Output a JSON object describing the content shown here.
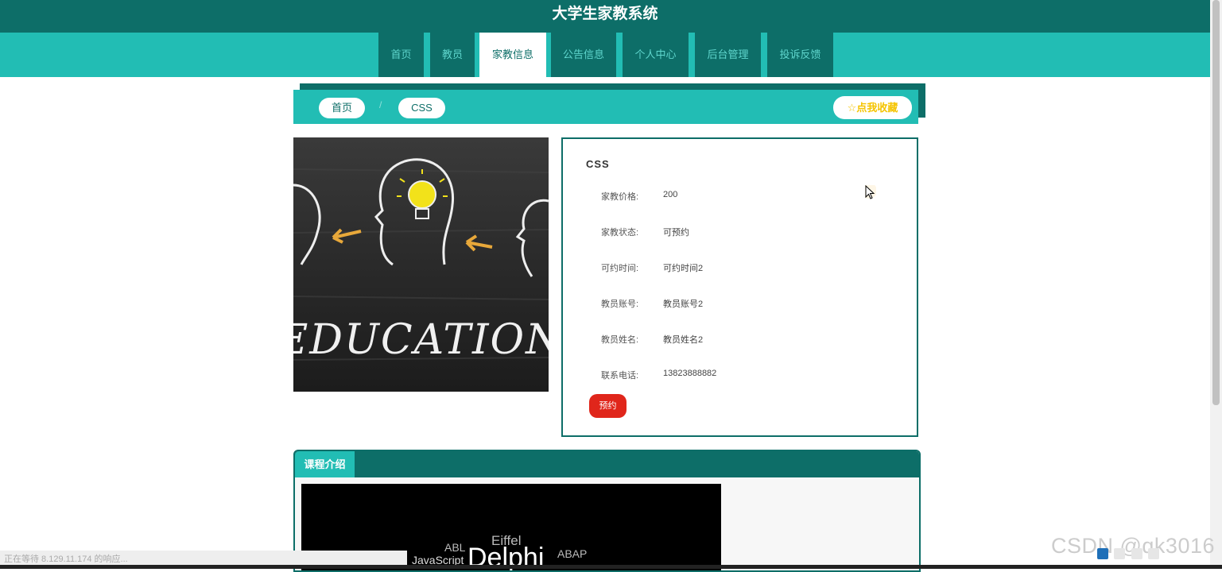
{
  "app_title": "大学生家教系统",
  "nav": [
    "首页",
    "教员",
    "家教信息",
    "公告信息",
    "个人中心",
    "后台管理",
    "投诉反馈"
  ],
  "nav_active": "家教信息",
  "breadcrumb": [
    "首页",
    "CSS"
  ],
  "favorite_label": "☆点我收藏",
  "hero_image_text": "EDUCATION",
  "detail": {
    "title": "CSS",
    "rows": [
      {
        "label": "家教价格:",
        "value": "200"
      },
      {
        "label": "家教状态:",
        "value": "可预约"
      },
      {
        "label": "可约时间:",
        "value": "可约时间2"
      },
      {
        "label": "教员账号:",
        "value": "教员账号2"
      },
      {
        "label": "教员姓名:",
        "value": "教员姓名2"
      },
      {
        "label": "联系电话:",
        "value": "13823888882"
      }
    ],
    "book_label": "预约"
  },
  "intro_tab": "课程介绍",
  "video_words": [
    "ABL",
    "Eiffel",
    "ABAP",
    "JavaScript",
    "Delphi"
  ],
  "status_text": "正在等待 8.129.11.174 的响应...",
  "watermark": "CSDN @qk3016",
  "colors": {
    "primary_dark": "#0d6e68",
    "primary": "#22bdb4",
    "book_button": "#e0261b",
    "favorite": "#f5c400"
  }
}
